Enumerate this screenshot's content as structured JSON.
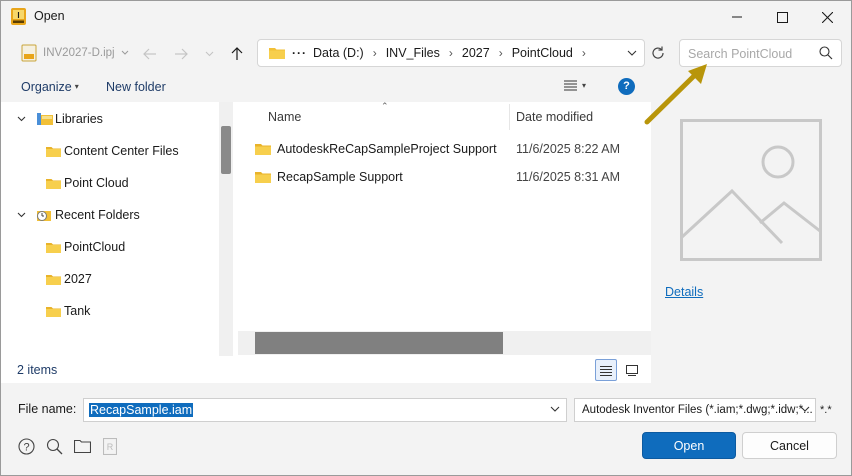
{
  "window": {
    "title": "Open"
  },
  "nav": {
    "recent_location": "INV2027-D.ipj",
    "breadcrumb": [
      "Data (D:)",
      "INV_Files",
      "2027",
      "PointCloud"
    ],
    "search_placeholder": "Search PointCloud"
  },
  "toolbar": {
    "organize_label": "Organize",
    "new_folder_label": "New folder",
    "help_label": "?"
  },
  "tree": {
    "items": [
      {
        "label": "Libraries"
      },
      {
        "label": "Content Center Files"
      },
      {
        "label": "Point Cloud"
      },
      {
        "label": "Recent Folders"
      },
      {
        "label": "PointCloud"
      },
      {
        "label": "2027"
      },
      {
        "label": "Tank"
      }
    ]
  },
  "files": {
    "columns": {
      "name": "Name",
      "date": "Date modified"
    },
    "rows": [
      {
        "name": "AutodeskReCapSampleProject Support",
        "date": "11/6/2025 8:22 AM"
      },
      {
        "name": "RecapSample Support",
        "date": "11/6/2025 8:31 AM"
      }
    ]
  },
  "preview": {
    "details_label": "Details"
  },
  "status": {
    "count": "2 items"
  },
  "bottom": {
    "file_name_label": "File name:",
    "file_name_value": "RecapSample.iam",
    "file_type_value": "Autodesk Inventor Files (*.iam;*.dwg;*.idw;*...",
    "extension_filter": "*.*",
    "open_label": "Open",
    "cancel_label": "Cancel"
  },
  "colors": {
    "accent": "#0f6cbd",
    "folder": "#f2c037",
    "annotation_arrow": "#b8950a"
  }
}
